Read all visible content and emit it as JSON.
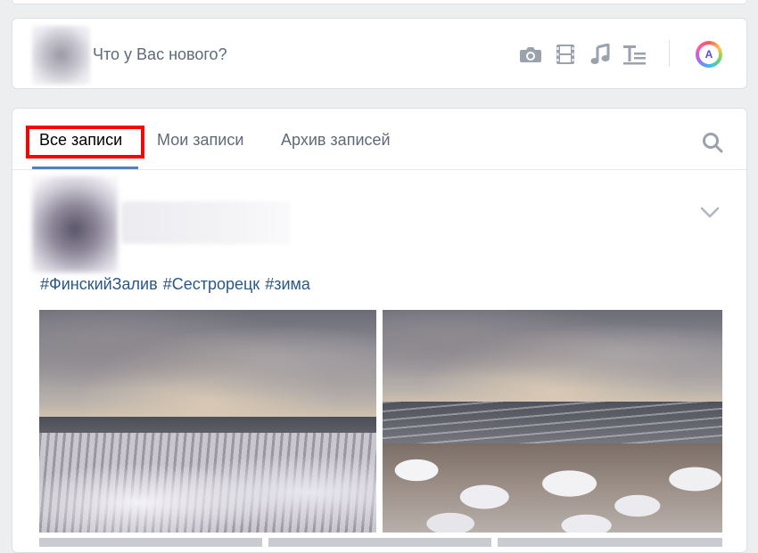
{
  "composer": {
    "placeholder": "Что у Вас нового?",
    "tools": [
      {
        "icon": "camera-icon"
      },
      {
        "icon": "video-icon"
      },
      {
        "icon": "music-icon"
      },
      {
        "icon": "article-icon"
      }
    ],
    "assistant_label": "A"
  },
  "feed": {
    "tabs": [
      {
        "label": "Все записи",
        "active": true
      },
      {
        "label": "Мои записи",
        "active": false
      },
      {
        "label": "Архив записей",
        "active": false
      }
    ],
    "post": {
      "hashtags": [
        "#ФинскийЗалив",
        "#Сестрорецк",
        "#зима"
      ]
    }
  },
  "colors": {
    "accent": "#5181b8",
    "link": "#2a5885",
    "highlight": "#ff0000",
    "icon": "#99a2ad"
  }
}
